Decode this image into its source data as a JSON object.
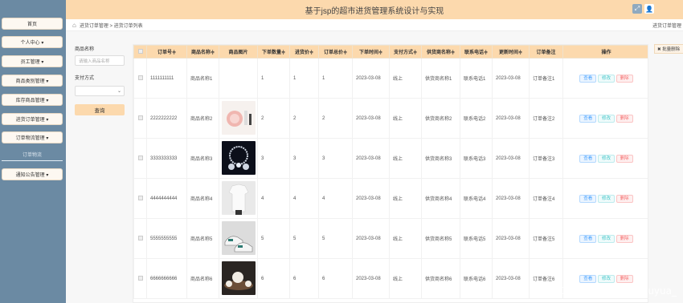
{
  "app": {
    "title": "基于jsp的超市进货管理系统设计与实现"
  },
  "sidebar": {
    "items": [
      {
        "label": "首页"
      },
      {
        "label": "个人中心 ▾"
      },
      {
        "label": "员工管理 ▾"
      },
      {
        "label": "商品类别管理 ▾"
      },
      {
        "label": "库存商品管理 ▾"
      },
      {
        "label": "进货订单管理 ▾"
      },
      {
        "label": "订单物流管理 ▾"
      },
      {
        "label": "通知公告管理 ▾"
      }
    ],
    "sub_item": "订单物流"
  },
  "breadcrumb": {
    "items": "进货订单管理 > 进货订单列表",
    "right": "进货订单管理"
  },
  "filter": {
    "name_label": "商品名称",
    "name_placeholder": "请输入商品名称",
    "pay_label": "支付方式",
    "search_label": "查询"
  },
  "batch_delete_label": "✖ 批量删除",
  "table": {
    "headers": [
      "",
      "订单号≑",
      "商品名称≑",
      "商品图片",
      "下单数量≑",
      "进货价≑",
      "订单总价≑",
      "下单时间≑",
      "支付方式≑",
      "供货商名称≑",
      "联系电话≑",
      "更新时间≑",
      "订单备注",
      "操作"
    ],
    "ops": {
      "view": "查看",
      "edit": "修改",
      "del": "删除"
    },
    "rows": [
      {
        "order": "1111111111",
        "name": "商品名称1",
        "img": "none",
        "qty": "1",
        "price": "1",
        "total": "1",
        "time": "2023-03-08",
        "pay": "线上",
        "supplier": "供货商名称1",
        "phone": "联系电话1",
        "updated": "2023-03-08",
        "note": "订单备注1"
      },
      {
        "order": "2222222222",
        "name": "商品名称2",
        "img": "cosmetics",
        "qty": "2",
        "price": "2",
        "total": "2",
        "time": "2023-03-08",
        "pay": "线上",
        "supplier": "供货商名称2",
        "phone": "联系电话2",
        "updated": "2023-03-08",
        "note": "订单备注2"
      },
      {
        "order": "3333333333",
        "name": "商品名称3",
        "img": "jewelry",
        "qty": "3",
        "price": "3",
        "total": "3",
        "time": "2023-03-08",
        "pay": "线上",
        "supplier": "供货商名称3",
        "phone": "联系电话3",
        "updated": "2023-03-08",
        "note": "订单备注3"
      },
      {
        "order": "4444444444",
        "name": "商品名称4",
        "img": "tshirt",
        "qty": "4",
        "price": "4",
        "total": "4",
        "time": "2023-03-08",
        "pay": "线上",
        "supplier": "供货商名称4",
        "phone": "联系电话4",
        "updated": "2023-03-08",
        "note": "订单备注4"
      },
      {
        "order": "5555555555",
        "name": "商品名称5",
        "img": "shoes",
        "qty": "5",
        "price": "5",
        "total": "5",
        "time": "2023-03-08",
        "pay": "线上",
        "supplier": "供货商名称5",
        "phone": "联系电话5",
        "updated": "2023-03-08",
        "note": "订单备注5"
      },
      {
        "order": "6666666666",
        "name": "商品名称6",
        "img": "teaset",
        "qty": "6",
        "price": "6",
        "total": "6",
        "time": "2023-03-08",
        "pay": "线上",
        "supplier": "供货商名称6",
        "phone": "联系电话6",
        "updated": "2023-03-08",
        "note": "订单备注6"
      }
    ]
  },
  "watermark": "CSDN @javachenxuyua_",
  "colors": {
    "topbar": "#fcd9ad",
    "sidebar": "#6b8aa3"
  }
}
